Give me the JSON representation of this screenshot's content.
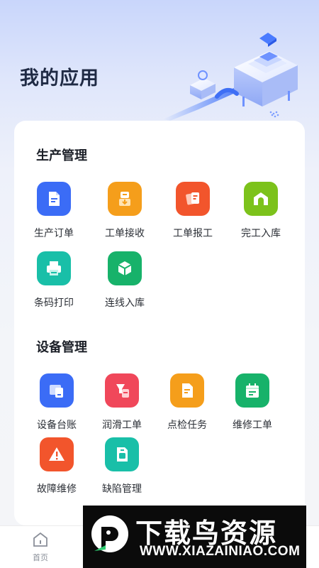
{
  "header": {
    "title": "我的应用"
  },
  "sections": [
    {
      "title": "生产管理",
      "apps": [
        {
          "label": "生产订单",
          "icon": "document-icon",
          "color": "#3b6cf6"
        },
        {
          "label": "工单接收",
          "icon": "receive-box-icon",
          "color": "#f59e1b"
        },
        {
          "label": "工单报工",
          "icon": "report-cards-icon",
          "color": "#f2552c"
        },
        {
          "label": "完工入库",
          "icon": "warehouse-icon",
          "color": "#7cc21b"
        },
        {
          "label": "条码打印",
          "icon": "printer-icon",
          "color": "#19bfa8"
        },
        {
          "label": "连线入库",
          "icon": "cube-icon",
          "color": "#17b26a"
        }
      ]
    },
    {
      "title": "设备管理",
      "apps": [
        {
          "label": "设备台账",
          "icon": "device-ledger-icon",
          "color": "#3b6cf6"
        },
        {
          "label": "润滑工单",
          "icon": "lubrication-icon",
          "color": "#f0475a"
        },
        {
          "label": "点检任务",
          "icon": "inspection-doc-icon",
          "color": "#f59e1b"
        },
        {
          "label": "维修工单",
          "icon": "calendar-repair-icon",
          "color": "#17b26a"
        },
        {
          "label": "故障维修",
          "icon": "warning-icon",
          "color": "#f2552c"
        },
        {
          "label": "缺陷管理",
          "icon": "sim-card-icon",
          "color": "#19bfa8"
        }
      ]
    }
  ],
  "tabbar": {
    "items": [
      {
        "label": "首页",
        "icon": "home-icon"
      }
    ]
  },
  "watermark": {
    "title": "下载鸟资源",
    "url": "WWW.XIAZAINIAO.COM"
  }
}
